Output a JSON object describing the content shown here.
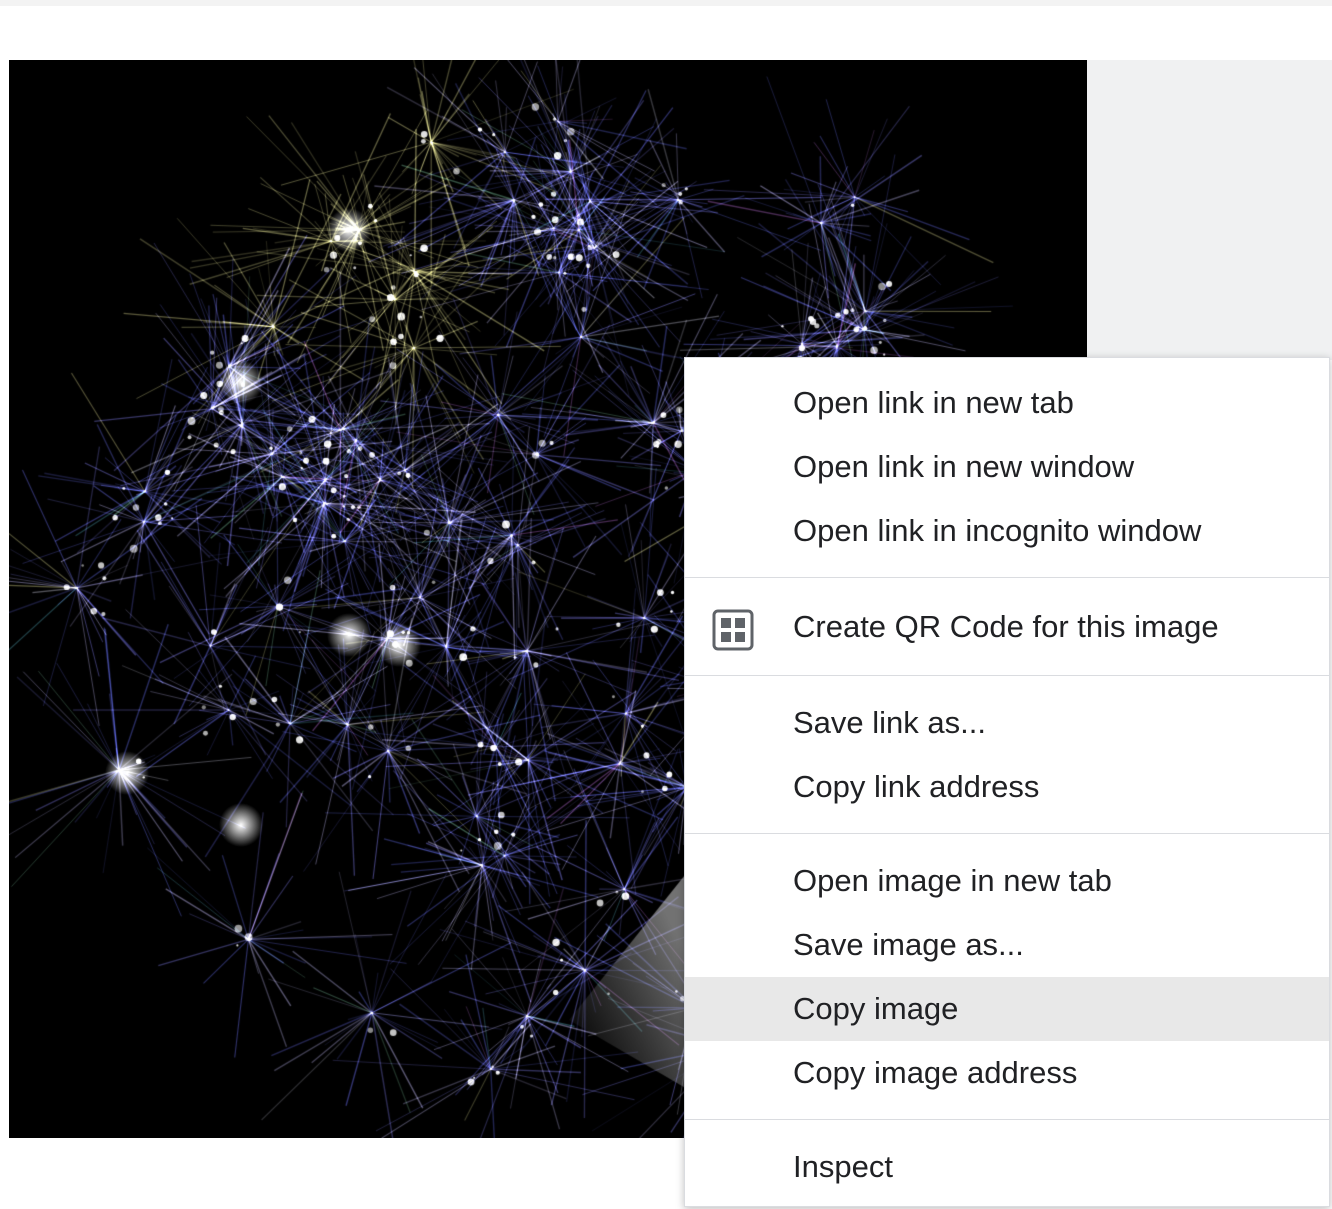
{
  "context_menu": {
    "groups": [
      {
        "items": [
          {
            "label": "Open link in new tab"
          },
          {
            "label": "Open link in new window"
          },
          {
            "label": "Open link in incognito window"
          }
        ]
      },
      {
        "items": [
          {
            "label": "Create QR Code for this image",
            "icon": "qr-code-icon"
          }
        ]
      },
      {
        "items": [
          {
            "label": "Save link as..."
          },
          {
            "label": "Copy link address"
          }
        ]
      },
      {
        "items": [
          {
            "label": "Open image in new tab"
          },
          {
            "label": "Save image as..."
          },
          {
            "label": "Copy image",
            "highlighted": true
          },
          {
            "label": "Copy image address"
          }
        ]
      },
      {
        "items": [
          {
            "label": "Inspect"
          }
        ]
      }
    ]
  },
  "image": {
    "subject": "network-visualization-image",
    "background_color": "#000000"
  },
  "colors": {
    "menu_background": "#ffffff",
    "menu_text": "#202124",
    "menu_highlight": "#e8e8e8",
    "separator": "#dadce0",
    "side_panel": "#f0f1f2"
  }
}
